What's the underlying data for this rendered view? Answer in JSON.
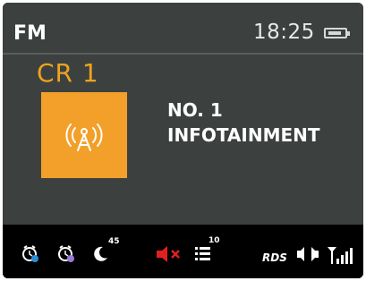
{
  "header": {
    "band": "FM",
    "time": "18:25"
  },
  "station": {
    "name": "CR 1",
    "radio_text_line1": "NO. 1",
    "radio_text_line2": "INFOTAINMENT",
    "logo_color": "#f2a02a"
  },
  "status_bar": {
    "sleep_minutes": "45",
    "list_count": "10",
    "rds_label": "RDS",
    "icons": [
      "alarm-1-icon",
      "alarm-2-icon",
      "sleep-timer-icon",
      "mute-icon",
      "station-list-icon",
      "rds-icon",
      "stereo-icon",
      "signal-strength-icon"
    ]
  },
  "colors": {
    "accent": "#f0a31c",
    "mute": "#e02020",
    "alarm_badge": "#2a8fd8"
  }
}
